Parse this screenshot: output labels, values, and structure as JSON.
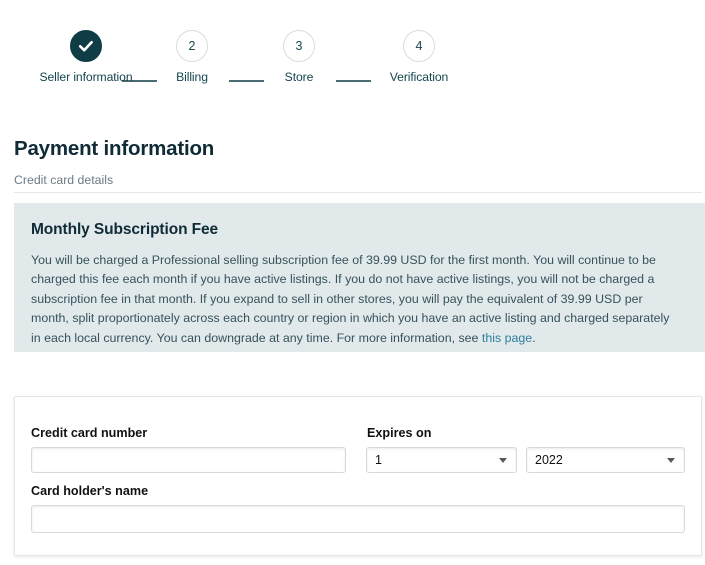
{
  "stepper": {
    "steps": [
      {
        "marker": "check-icon",
        "label": "Seller information",
        "state": "completed"
      },
      {
        "marker": "2",
        "label": "Billing",
        "state": "upcoming"
      },
      {
        "marker": "3",
        "label": "Store",
        "state": "upcoming"
      },
      {
        "marker": "4",
        "label": "Verification",
        "state": "upcoming"
      }
    ]
  },
  "header": {
    "title": "Payment information",
    "subtitle": "Credit card details"
  },
  "info_panel": {
    "title": "Monthly Subscription Fee",
    "body_before_link": "You will be charged a Professional selling subscription fee of 39.99 USD for the first month. You will continue to be charged this fee each month if you have active listings. If you do not have active listings, you will not be charged a subscription fee in that month. If you expand to sell in other stores, you will pay the equivalent of 39.99 USD per month, split proportionately across each country or region in which you have an active listing and charged separately in each local currency. You can downgrade at any time. For more information, see ",
    "link_text": "this page",
    "body_after_link": ".",
    "background_color": "#e1e9eb"
  },
  "form": {
    "credit_card_number": {
      "label": "Credit card number",
      "value": "",
      "placeholder": ""
    },
    "expires_on": {
      "label": "Expires on",
      "month_value": "1",
      "year_value": "2022"
    },
    "card_holder_name": {
      "label": "Card holder's name",
      "value": "",
      "placeholder": ""
    }
  },
  "colors": {
    "accent_dark": "#0f3d46",
    "link": "#2e7d9c",
    "panel": "#e1e9eb"
  }
}
